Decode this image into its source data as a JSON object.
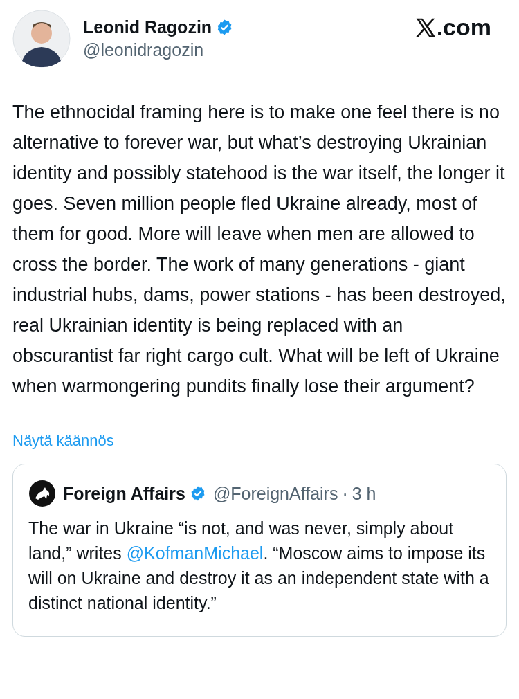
{
  "author": {
    "name": "Leonid Ragozin",
    "verified": true,
    "handle": "@leonidragozin"
  },
  "site": ".com",
  "text": "The ethnocidal framing here is to make one feel there is no alternative to forever war, but what’s destroying Ukrainian identity and possibly statehood is the war itself, the longer it goes. Seven million people fled Ukraine already, most of them for good. More will leave when men are allowed to cross the border. The work of many generations - giant industrial hubs, dams, power stations - has been destroyed, real Ukrainian identity is being replaced with an obscurantist far right cargo cult. What will be left of Ukraine when warmongering pundits finally lose their argument?",
  "translate_link": "Näytä käännös",
  "quote": {
    "name": "Foreign Affairs",
    "verified": true,
    "handle": "@ForeignAffairs",
    "separator": "·",
    "time": "3 h",
    "parts": [
      {
        "kind": "text",
        "text": "The war in Ukraine “is not, and was never, simply about land,” writes "
      },
      {
        "kind": "mention",
        "text": "@KofmanMichael"
      },
      {
        "kind": "text",
        "text": ". “Moscow aims to impose its will on Ukraine and destroy it as an independent state with a distinct national identity.”"
      }
    ]
  }
}
